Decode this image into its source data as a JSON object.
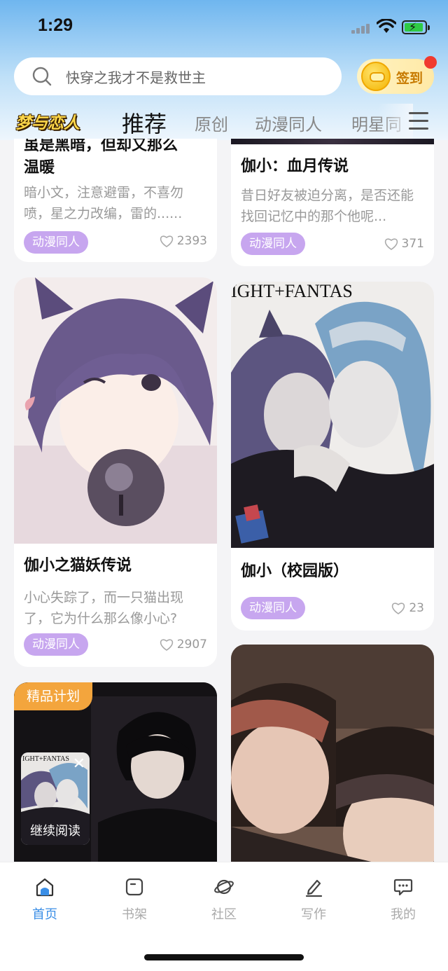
{
  "status": {
    "time": "1:29"
  },
  "search": {
    "placeholder": "快穿之我才不是救世主"
  },
  "checkin": {
    "label": "签到"
  },
  "tabs": {
    "logo": "梦与恋人",
    "items": [
      "推荐",
      "原创",
      "动漫同人",
      "明星同"
    ],
    "active": "推荐"
  },
  "feed": {
    "cards": [
      {
        "title_lines": [
          "虽是黑暗，但却又那么",
          "温暖"
        ],
        "desc": "暗小文，注意避雷，不喜勿喷，星之力改编，雷的......",
        "tag": "动漫同人",
        "likes": "2393"
      },
      {
        "title": "伽小：血月传说",
        "desc": "昔日好友被迫分离，是否还能找回记忆中的那个他呢...",
        "tag": "动漫同人",
        "likes": "371"
      },
      {
        "title": "伽小之猫妖传说",
        "desc": "小心失踪了，而一只猫出现了，它为什么那么像小心?",
        "tag": "动漫同人",
        "likes": "2907"
      },
      {
        "title": "伽小（校园版）",
        "tag": "动漫同人",
        "likes": "23",
        "art_text": "IGHT+FANTAS"
      },
      {
        "badge": "精品计划"
      }
    ],
    "continue_reading": {
      "label": "继续阅读",
      "close": "✕"
    }
  },
  "nav": {
    "items": [
      {
        "label": "首页",
        "icon": "home-icon"
      },
      {
        "label": "书架",
        "icon": "bookshelf-icon"
      },
      {
        "label": "社区",
        "icon": "planet-icon"
      },
      {
        "label": "写作",
        "icon": "pen-icon"
      },
      {
        "label": "我的",
        "icon": "chat-bubble-icon"
      }
    ],
    "active_color": "#3a8ee6"
  },
  "colors": {
    "tag": "#c7a6ef",
    "badge": "#f3a53d",
    "header": "#6fb6ef"
  }
}
